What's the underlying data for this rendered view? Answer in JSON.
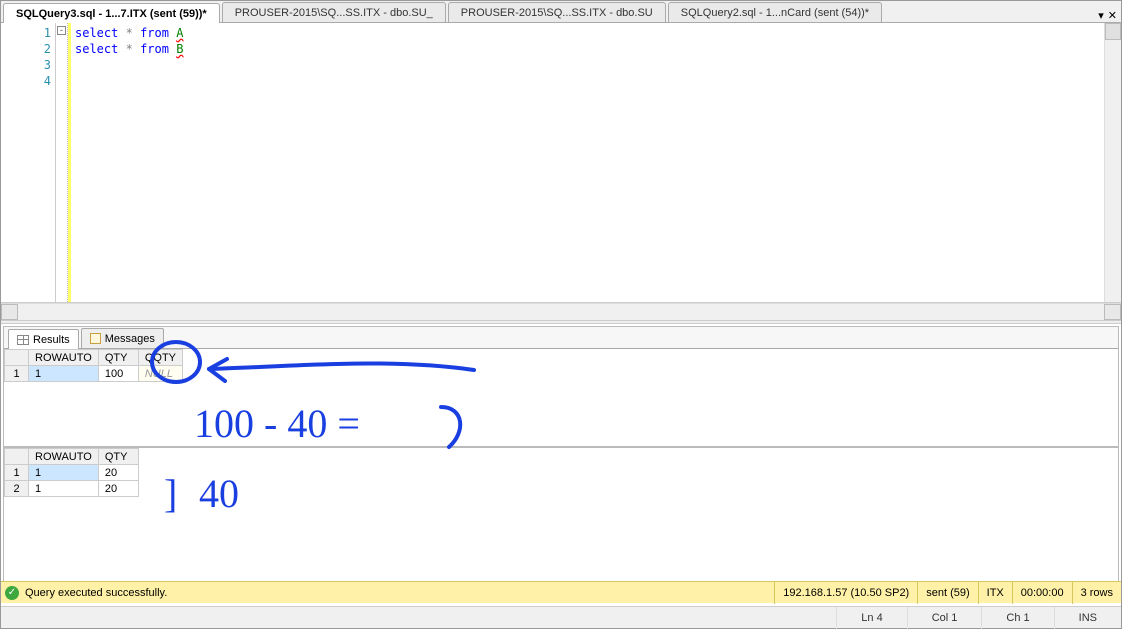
{
  "tabs": [
    {
      "label": "SQLQuery3.sql - 1...7.ITX (sent (59))*",
      "active": true
    },
    {
      "label": "PROUSER-2015\\SQ...SS.ITX - dbo.SU_",
      "active": false
    },
    {
      "label": "PROUSER-2015\\SQ...SS.ITX - dbo.SU",
      "active": false
    },
    {
      "label": "SQLQuery2.sql - 1...nCard (sent (54))*",
      "active": false
    }
  ],
  "editor": {
    "lines": [
      "1",
      "2",
      "3",
      "4"
    ],
    "code_parts": {
      "kw_select": "select",
      "star": "*",
      "kw_from": "from",
      "tblA": "A",
      "tblB": "B"
    }
  },
  "result_tabs": {
    "results": "Results",
    "messages": "Messages"
  },
  "grid1": {
    "headers": [
      "ROWAUTO",
      "QTY",
      "QQTY"
    ],
    "rows": [
      {
        "n": "1",
        "c": [
          "1",
          "100",
          "NULL"
        ]
      }
    ]
  },
  "grid2": {
    "headers": [
      "ROWAUTO",
      "QTY"
    ],
    "rows": [
      {
        "n": "1",
        "c": [
          "1",
          "20"
        ]
      },
      {
        "n": "2",
        "c": [
          "1",
          "20"
        ]
      }
    ]
  },
  "annotation": {
    "line1": "100 - 40 =",
    "line2part1": "]",
    "line2part2": "40"
  },
  "status_success": {
    "msg": "Query executed successfully.",
    "server": "192.168.1.57 (10.50 SP2)",
    "user": "sent (59)",
    "db": "ITX",
    "time": "00:00:00",
    "rows": "3 rows"
  },
  "status_bottom": {
    "ln": "Ln 4",
    "col": "Col 1",
    "ch": "Ch 1",
    "ins": "INS"
  }
}
